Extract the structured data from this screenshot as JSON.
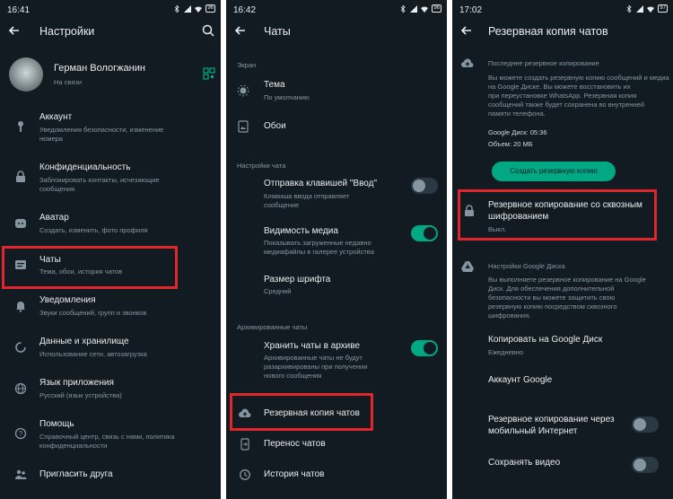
{
  "p1": {
    "status_time": "16:41",
    "battery": "96",
    "title": "Настройки",
    "profile": {
      "name": "Герман Вологжанин",
      "status": "На связи"
    },
    "items": [
      {
        "title": "Аккаунт",
        "sub": "Уведомления безопасности, изменение номера",
        "sub1": "Уведомления безопасности, изменение",
        "sub2": "номера"
      },
      {
        "title": "Конфиденциальность",
        "sub1": "Заблокировать контакты, исчезающие",
        "sub2": "сообщения"
      },
      {
        "title": "Аватар",
        "sub1": "Создать, изменить, фото профиля"
      },
      {
        "title": "Чаты",
        "sub1": "Тема, обои, история чатов"
      },
      {
        "title": "Уведомления",
        "sub1": "Звуки сообщений, групп и звонков"
      },
      {
        "title": "Данные и хранилище",
        "sub1": "Использование сети, автозагрузка"
      },
      {
        "title": "Язык приложения",
        "sub1": "Русский (язык устройства)"
      },
      {
        "title": "Помощь",
        "sub1": "Справочный центр, связь с нами, политика",
        "sub2": "конфиденциальности"
      },
      {
        "title": "Пригласить друга"
      }
    ]
  },
  "p2": {
    "status_time": "16:42",
    "battery": "96",
    "title": "Чаты",
    "section_screen": "Экран",
    "theme": {
      "title": "Тема",
      "sub": "По умолчанию"
    },
    "wallpaper": "Обои",
    "section_chat": "Настройки чата",
    "enter": {
      "title": "Отправка клавишей \"Ввод\"",
      "sub1": "Клавиша ввода отправляет",
      "sub2": "сообщение"
    },
    "media": {
      "title": "Видимость медиа",
      "sub1": "Показывать загруженные недавно",
      "sub2": "медиафайлы в галерее устройства"
    },
    "font": {
      "title": "Размер шрифта",
      "sub": "Средний"
    },
    "section_archive": "Архивированные чаты",
    "archive": {
      "title": "Хранить чаты в архиве",
      "sub1": "Архивированные чаты не будут",
      "sub2": "разархивированы при получении",
      "sub3": "нового сообщения"
    },
    "backup": "Резервная копия чатов",
    "transfer": "Перенос чатов",
    "history": "История чатов"
  },
  "p3": {
    "status_time": "17:02",
    "battery": "97",
    "title": "Резервная копия чатов",
    "last_backup_header": "Последнее резервное копирование",
    "desc": [
      "Вы можете создать резервную копию сообщений и медиа",
      "на Google Диске. Вы можете восстановить их",
      "при переустановке WhatsApp. Резервная копия",
      "сообщений также будет сохранена во внутренней",
      "памяти телефона."
    ],
    "gdrive_time": "Google Диск: 05:36",
    "size": "Объем: 20 МБ",
    "create_button": "Создать резервную копию",
    "e2e": {
      "title1": "Резервное копирование со сквозным",
      "title2": "шифрованием",
      "sub": "Выкл."
    },
    "gdrive_header": "Настройки Google Диска",
    "gdrive_desc": [
      "Вы выполняете резервное копирование на Google",
      "Диск. Для обеспечения дополнительной",
      "безопасности вы можете защитить свою",
      "резервную копию посредством сквозного",
      "шифрования."
    ],
    "copy_to": {
      "title": "Копировать на Google Диск",
      "sub": "Ежедневно"
    },
    "account": "Аккаунт Google",
    "mobile": {
      "title1": "Резервное копирование через",
      "title2": "мобильный Интернет"
    },
    "video": "Сохранять видео"
  },
  "colors": {
    "bg": "#121b22",
    "accent": "#00a884",
    "highlight": "#e0262d"
  }
}
